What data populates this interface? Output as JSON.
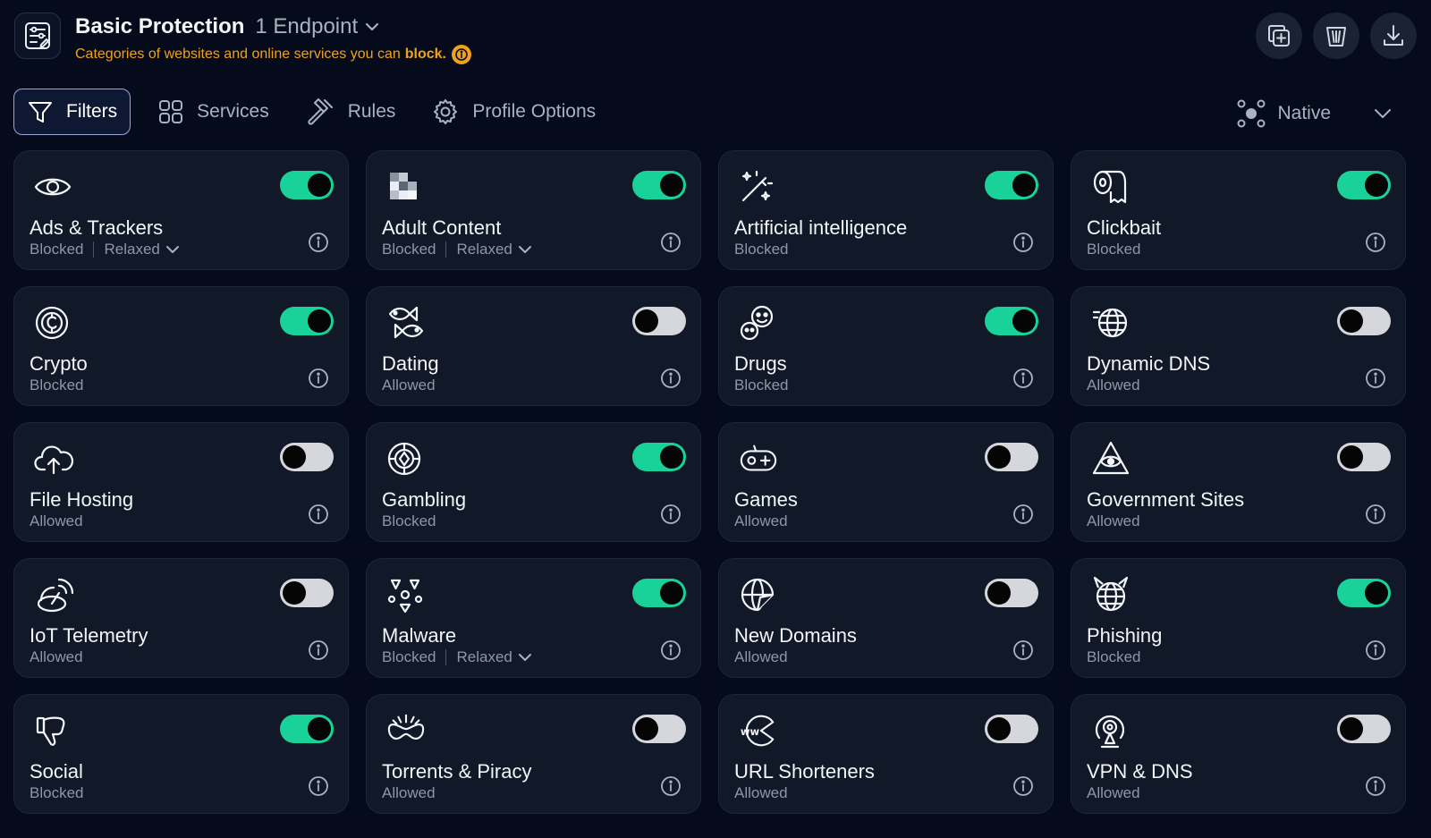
{
  "header": {
    "title": "Basic Protection",
    "endpoint_label": "1 Endpoint",
    "subtitle_text": "Categories of websites and online services you can",
    "subtitle_emphasis": "block.",
    "app_icon": "sliders-edit-icon",
    "actions": [
      {
        "name": "duplicate-profile-button",
        "icon": "copy-plus-icon"
      },
      {
        "name": "delete-profile-button",
        "icon": "trash-icon"
      },
      {
        "name": "download-profile-button",
        "icon": "download-icon"
      }
    ]
  },
  "tabs": [
    {
      "label": "Filters",
      "icon": "filter-icon",
      "active": true
    },
    {
      "label": "Services",
      "icon": "grid-icon",
      "active": false
    },
    {
      "label": "Rules",
      "icon": "gavel-icon",
      "active": false
    },
    {
      "label": "Profile Options",
      "icon": "gear-icon",
      "active": false
    }
  ],
  "mode_select": {
    "label": "Native",
    "icon": "native-nodes-icon"
  },
  "colors": {
    "accent": "#19d29a",
    "warning": "#f0a11c",
    "background": "#050b1a",
    "card": "#111827"
  },
  "filters": [
    {
      "name": "Ads & Trackers",
      "status": "Blocked",
      "mode": "Relaxed",
      "enabled": true,
      "icon": "eye-icon"
    },
    {
      "name": "Adult Content",
      "status": "Blocked",
      "mode": "Relaxed",
      "enabled": true,
      "icon": "pixelated-icon"
    },
    {
      "name": "Artificial intelligence",
      "status": "Blocked",
      "enabled": true,
      "icon": "magic-wand-icon"
    },
    {
      "name": "Clickbait",
      "status": "Blocked",
      "enabled": true,
      "icon": "toilet-paper-icon"
    },
    {
      "name": "Crypto",
      "status": "Blocked",
      "enabled": true,
      "icon": "coin-icon"
    },
    {
      "name": "Dating",
      "status": "Allowed",
      "enabled": false,
      "icon": "fish-icon"
    },
    {
      "name": "Drugs",
      "status": "Blocked",
      "enabled": true,
      "icon": "pills-icon"
    },
    {
      "name": "Dynamic DNS",
      "status": "Allowed",
      "enabled": false,
      "icon": "globe-network-icon"
    },
    {
      "name": "File Hosting",
      "status": "Allowed",
      "enabled": false,
      "icon": "cloud-upload-icon"
    },
    {
      "name": "Gambling",
      "status": "Blocked",
      "enabled": true,
      "icon": "casino-chip-icon"
    },
    {
      "name": "Games",
      "status": "Allowed",
      "enabled": false,
      "icon": "gamepad-icon"
    },
    {
      "name": "Government Sites",
      "status": "Allowed",
      "enabled": false,
      "icon": "pyramid-eye-icon"
    },
    {
      "name": "IoT Telemetry",
      "status": "Allowed",
      "enabled": false,
      "icon": "satellite-dish-icon"
    },
    {
      "name": "Malware",
      "status": "Blocked",
      "mode": "Relaxed",
      "enabled": true,
      "icon": "biohazard-icon"
    },
    {
      "name": "New Domains",
      "status": "Allowed",
      "enabled": false,
      "icon": "globe-sticker-icon"
    },
    {
      "name": "Phishing",
      "status": "Blocked",
      "enabled": true,
      "icon": "devil-globe-icon"
    },
    {
      "name": "Social",
      "status": "Blocked",
      "enabled": true,
      "icon": "thumbs-down-icon"
    },
    {
      "name": "Torrents & Piracy",
      "status": "Allowed",
      "enabled": false,
      "icon": "eyepatch-icon"
    },
    {
      "name": "URL Shorteners",
      "status": "Allowed",
      "enabled": false,
      "icon": "www-pacman-icon"
    },
    {
      "name": "VPN & DNS",
      "status": "Allowed",
      "enabled": false,
      "icon": "vpn-pin-icon"
    }
  ]
}
